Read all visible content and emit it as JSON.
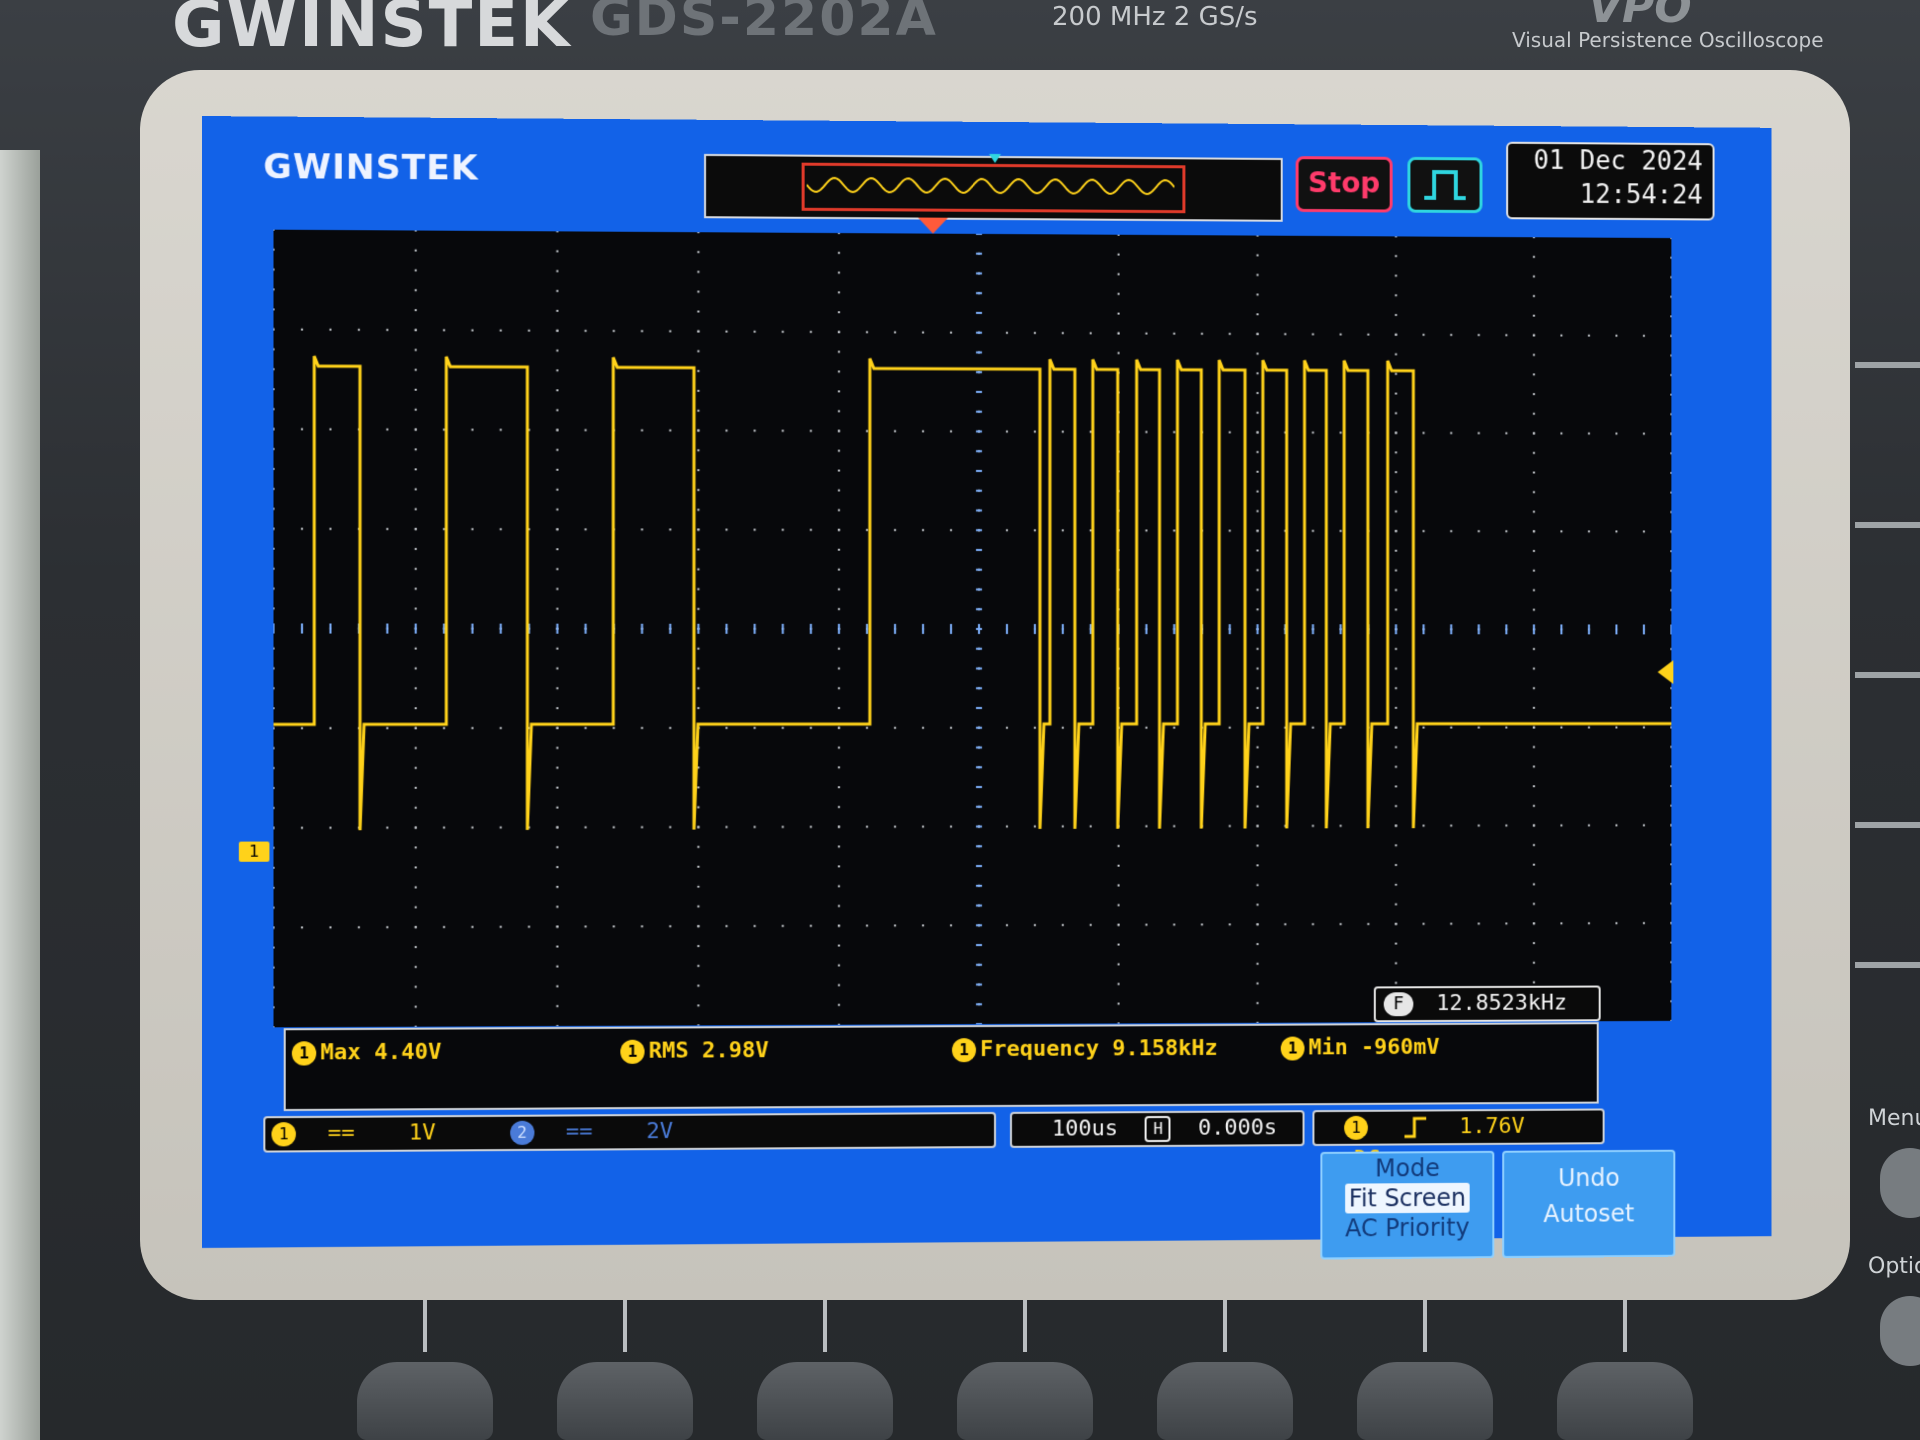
{
  "instrument": {
    "brand": "GWINSTEK",
    "model": "GDS-2202A",
    "specs": "200 MHz   2 GS/s",
    "tagline": "Visual Persistence Oscilloscope",
    "vpo_logo": "VPO"
  },
  "screen": {
    "logo": "GWINSTEK",
    "run_state": "Stop",
    "trigger_mode_icon": "square-pulse-icon",
    "date": "01 Dec 2024",
    "time": "12:54:24"
  },
  "waveform": {
    "channel_marker": "1",
    "trace_color": "#ffd21a",
    "description_source": "channel 1 square wave, first half lower frequency, second half higher frequency"
  },
  "frequency_counter": {
    "label": "F",
    "value": "12.8523kHz"
  },
  "measurements": [
    {
      "channel": "1",
      "label": "Max 4.40V"
    },
    {
      "channel": "1",
      "label": "RMS 2.98V"
    },
    {
      "channel": "1",
      "label": "Frequency 9.158kHz"
    },
    {
      "channel": "1",
      "label": "Min -960mV"
    }
  ],
  "status": {
    "ch1": {
      "id": "1",
      "coupling": "==",
      "scale": "1V"
    },
    "ch2": {
      "id": "2",
      "coupling": "==",
      "scale": "2V"
    },
    "timebase": "100us",
    "timebase_icon": "H",
    "position": "0.000s",
    "trigger_source": "1",
    "trigger_slope_icon": "rising-edge-icon",
    "trigger_level": "1.76V",
    "trigger_coupling": "DC"
  },
  "softkeys": {
    "mode_title": "Mode",
    "mode_selected": "Fit Screen",
    "mode_option": "AC Priority",
    "undo_line1": "Undo",
    "undo_line2": "Autoset"
  },
  "side_labels": {
    "menu": "Menu",
    "option": "Option"
  },
  "colors": {
    "screen_bg": "#1262e8",
    "trace": "#ffd21a",
    "stop": "#ff3b6b",
    "grid_dots": "#c9cdd2"
  }
}
